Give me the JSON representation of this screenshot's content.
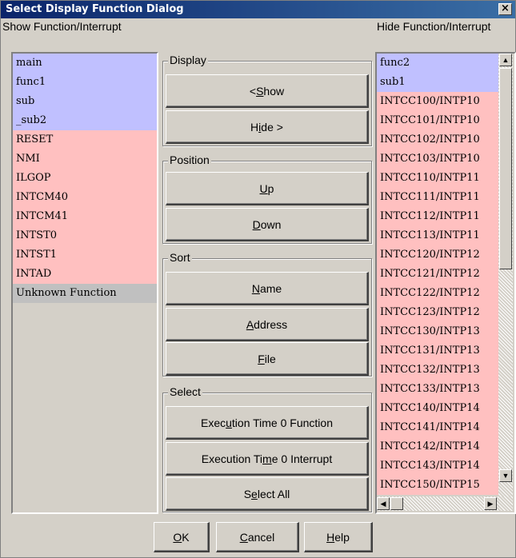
{
  "window": {
    "title": "Select Display Function Dialog",
    "close_glyph": "×"
  },
  "show_pane": {
    "label": "Show Function/Interrupt",
    "items": [
      {
        "text": "main",
        "color": "#c0c0ff"
      },
      {
        "text": "func1",
        "color": "#c0c0ff"
      },
      {
        "text": "sub",
        "color": "#c0c0ff"
      },
      {
        "text": "_sub2",
        "color": "#c0c0ff"
      },
      {
        "text": "RESET",
        "color": "#ffc0c0"
      },
      {
        "text": "NMI",
        "color": "#ffc0c0"
      },
      {
        "text": "ILGOP",
        "color": "#ffc0c0"
      },
      {
        "text": "INTCM40",
        "color": "#ffc0c0"
      },
      {
        "text": "INTCM41",
        "color": "#ffc0c0"
      },
      {
        "text": "INTST0",
        "color": "#ffc0c0"
      },
      {
        "text": "INTST1",
        "color": "#ffc0c0"
      },
      {
        "text": "INTAD",
        "color": "#ffc0c0"
      },
      {
        "text": "Unknown Function",
        "color": "#c0c0c0"
      }
    ]
  },
  "hide_pane": {
    "label": "Hide Function/Interrupt",
    "items": [
      {
        "text": "func2",
        "color": "#c0c0ff"
      },
      {
        "text": "sub1",
        "color": "#c0c0ff"
      },
      {
        "text": "INTCC100/INTP10",
        "color": "#ffc0c0"
      },
      {
        "text": "INTCC101/INTP10",
        "color": "#ffc0c0"
      },
      {
        "text": "INTCC102/INTP10",
        "color": "#ffc0c0"
      },
      {
        "text": "INTCC103/INTP10",
        "color": "#ffc0c0"
      },
      {
        "text": "INTCC110/INTP11",
        "color": "#ffc0c0"
      },
      {
        "text": "INTCC111/INTP11",
        "color": "#ffc0c0"
      },
      {
        "text": "INTCC112/INTP11",
        "color": "#ffc0c0"
      },
      {
        "text": "INTCC113/INTP11",
        "color": "#ffc0c0"
      },
      {
        "text": "INTCC120/INTP12",
        "color": "#ffc0c0"
      },
      {
        "text": "INTCC121/INTP12",
        "color": "#ffc0c0"
      },
      {
        "text": "INTCC122/INTP12",
        "color": "#ffc0c0"
      },
      {
        "text": "INTCC123/INTP12",
        "color": "#ffc0c0"
      },
      {
        "text": "INTCC130/INTP13",
        "color": "#ffc0c0"
      },
      {
        "text": "INTCC131/INTP13",
        "color": "#ffc0c0"
      },
      {
        "text": "INTCC132/INTP13",
        "color": "#ffc0c0"
      },
      {
        "text": "INTCC133/INTP13",
        "color": "#ffc0c0"
      },
      {
        "text": "INTCC140/INTP14",
        "color": "#ffc0c0"
      },
      {
        "text": "INTCC141/INTP14",
        "color": "#ffc0c0"
      },
      {
        "text": "INTCC142/INTP14",
        "color": "#ffc0c0"
      },
      {
        "text": "INTCC143/INTP14",
        "color": "#ffc0c0"
      },
      {
        "text": "INTCC150/INTP15",
        "color": "#ffc0c0"
      }
    ]
  },
  "display_group": {
    "label": "Display",
    "show_btn": {
      "pre": "< ",
      "u": "S",
      "post": "how"
    },
    "hide_btn": {
      "pre": "H",
      "u": "i",
      "post": "de >"
    }
  },
  "position_group": {
    "label": "Position",
    "up_btn": {
      "pre": "",
      "u": "U",
      "post": "p"
    },
    "down_btn": {
      "pre": "",
      "u": "D",
      "post": "own"
    }
  },
  "sort_group": {
    "label": "Sort",
    "name_btn": {
      "pre": "",
      "u": "N",
      "post": "ame"
    },
    "address_btn": {
      "pre": "",
      "u": "A",
      "post": "ddress"
    },
    "file_btn": {
      "pre": "",
      "u": "F",
      "post": "ile"
    }
  },
  "select_group": {
    "label": "Select",
    "exec0_func_btn": {
      "pre": "Exec",
      "u": "u",
      "post": "tion Time 0 Function"
    },
    "exec0_int_btn": {
      "pre": "Execution Ti",
      "u": "m",
      "post": "e 0 Interrupt"
    },
    "select_all_btn": {
      "pre": "S",
      "u": "e",
      "post": "lect All"
    }
  },
  "footer": {
    "ok_btn": {
      "pre": "",
      "u": "O",
      "post": "K"
    },
    "cancel_btn": {
      "pre": "",
      "u": "C",
      "post": "ancel"
    },
    "help_btn": {
      "pre": "",
      "u": "H",
      "post": "elp"
    }
  },
  "scrollbar": {
    "up_glyph": "▲",
    "down_glyph": "▼",
    "left_glyph": "◀",
    "right_glyph": "▶"
  }
}
